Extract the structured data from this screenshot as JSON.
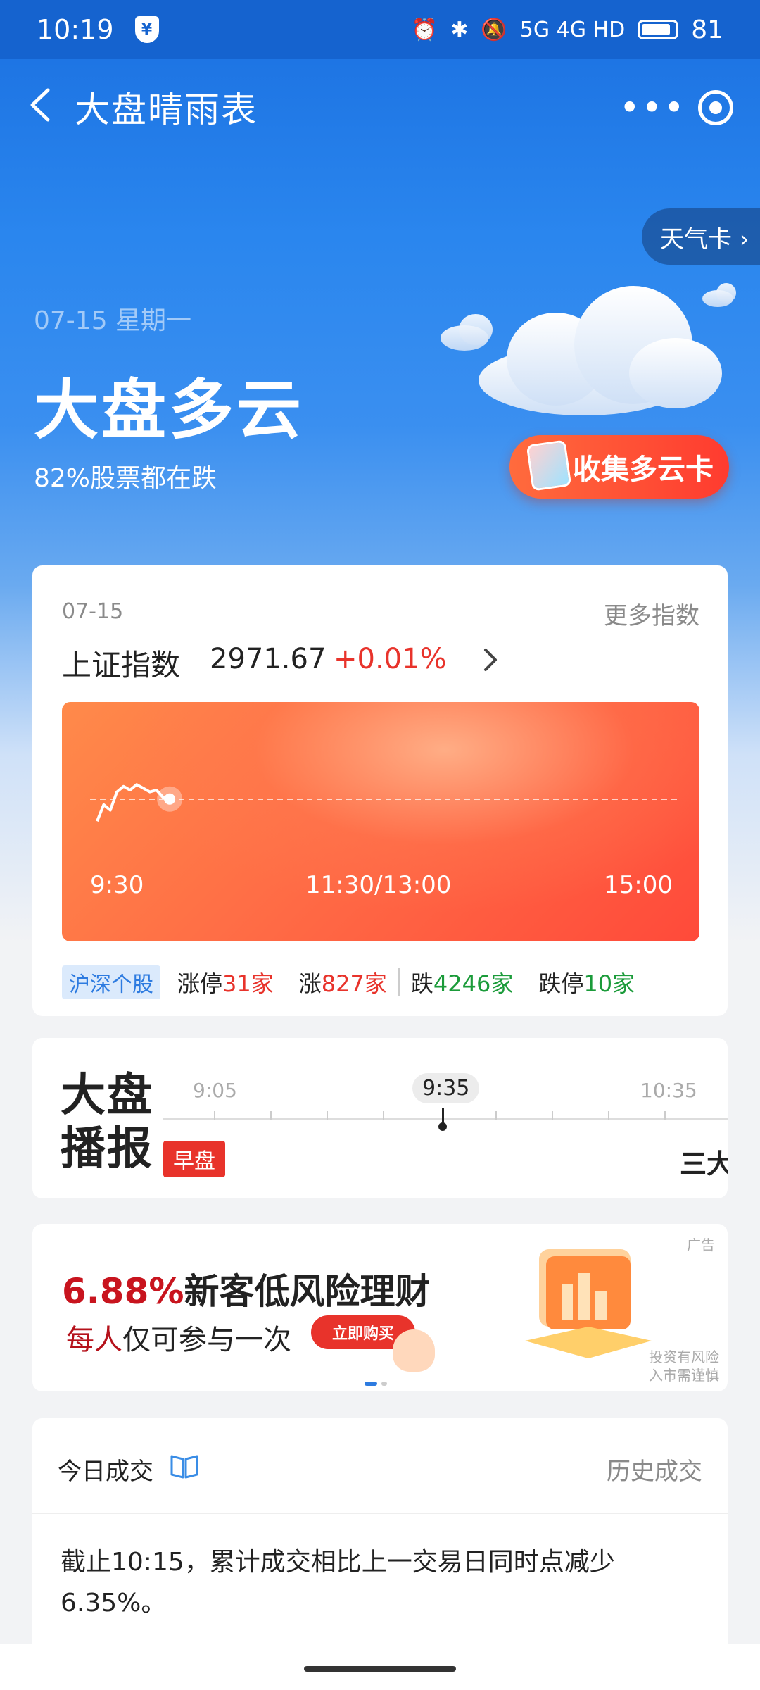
{
  "status": {
    "time": "10:19",
    "network": "5G 4G HD",
    "battery": "81"
  },
  "nav": {
    "title": "大盘晴雨表",
    "more": "•••"
  },
  "hero": {
    "weather_card_btn": "天气卡 ›",
    "date": "07-15  星期一",
    "title": "大盘多云",
    "subtitle": "82%股票都在跌",
    "collect_btn": "收集多云卡"
  },
  "index_card": {
    "date": "07-15",
    "more": "更多指数",
    "name": "上证指数",
    "value": "2971.67",
    "change": "+0.01%",
    "ticks": [
      "9:30",
      "11:30/13:00",
      "15:00"
    ],
    "stats": {
      "tag": "沪深个股",
      "limit_up_label": "涨停",
      "limit_up_value": "31家",
      "up_label": "涨",
      "up_value": "827家",
      "down_label": "跌",
      "down_value": "4246家",
      "limit_down_label": "跌停",
      "limit_down_value": "10家"
    }
  },
  "broadcast": {
    "logo": "大盘\n播报",
    "tag": "早盘",
    "times": [
      "9:05",
      "9:35",
      "10:35"
    ],
    "preview": "三大"
  },
  "ad": {
    "label": "广告",
    "title_pct": "6.88%",
    "title_rest": "新客低风险理财",
    "sub_hl": "每人",
    "sub_rest": "仅可参与一次",
    "buy": "立即购买",
    "risk_line1": "投资有风险",
    "risk_line2": "入市需谨慎"
  },
  "volume": {
    "title": "今日成交",
    "history": "历史成交",
    "text": "截止10:15，累计成交相比上一交易日同时点减少6.35%。"
  },
  "chart_data": {
    "type": "line",
    "x_ticks": [
      "9:30",
      "11:30/13:00",
      "15:00"
    ],
    "series": [
      {
        "values": [
          -1.2,
          -0.3,
          -0.6,
          0.4,
          0.7,
          0.5,
          0.8,
          0.6,
          0.4,
          0.5,
          0.1,
          0.01
        ]
      }
    ],
    "baseline": 0
  }
}
